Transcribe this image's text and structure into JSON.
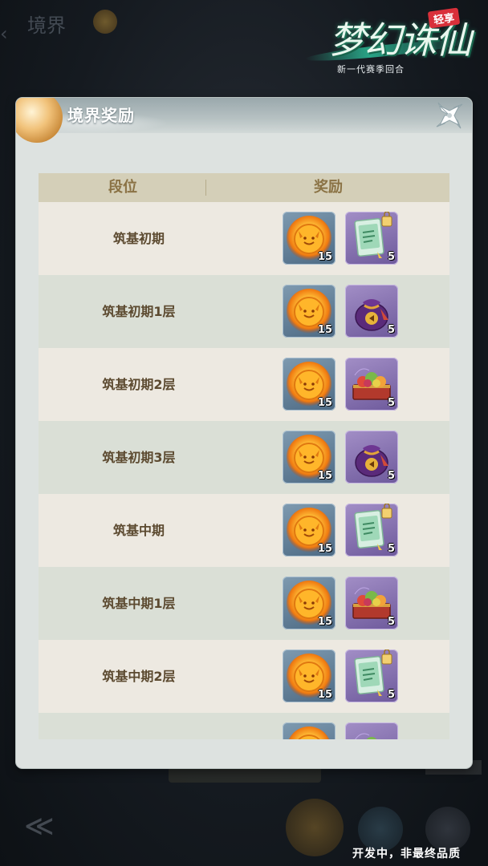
{
  "background": {
    "title": "境界",
    "logo": {
      "main": "梦幻诛仙",
      "tag": "轻享",
      "subtitle": "新一代赛季回合"
    },
    "footer_note": "开发中，非最终品质"
  },
  "dialog": {
    "title": "境界奖励",
    "columns": {
      "rank": "段位",
      "reward": "奖励"
    },
    "rows": [
      {
        "label": "筑基初期",
        "rewards": [
          {
            "icon": "fox-coin-icon",
            "qty": "15"
          },
          {
            "icon": "ticket-icon",
            "qty": "5"
          }
        ]
      },
      {
        "label": "筑基初期1层",
        "rewards": [
          {
            "icon": "fox-coin-icon",
            "qty": "15"
          },
          {
            "icon": "pouch-icon",
            "qty": "5"
          }
        ]
      },
      {
        "label": "筑基初期2层",
        "rewards": [
          {
            "icon": "fox-coin-icon",
            "qty": "15"
          },
          {
            "icon": "fruit-chest-icon",
            "qty": "5"
          }
        ]
      },
      {
        "label": "筑基初期3层",
        "rewards": [
          {
            "icon": "fox-coin-icon",
            "qty": "15"
          },
          {
            "icon": "pouch-icon",
            "qty": "5"
          }
        ]
      },
      {
        "label": "筑基中期",
        "rewards": [
          {
            "icon": "fox-coin-icon",
            "qty": "15"
          },
          {
            "icon": "ticket-icon",
            "qty": "5"
          }
        ]
      },
      {
        "label": "筑基中期1层",
        "rewards": [
          {
            "icon": "fox-coin-icon",
            "qty": "15"
          },
          {
            "icon": "fruit-chest-icon",
            "qty": "5"
          }
        ]
      },
      {
        "label": "筑基中期2层",
        "rewards": [
          {
            "icon": "fox-coin-icon",
            "qty": "15"
          },
          {
            "icon": "ticket-icon",
            "qty": "5"
          }
        ]
      },
      {
        "label": "",
        "rewards": [
          {
            "icon": "fox-coin-icon",
            "qty": ""
          },
          {
            "icon": "fruit-chest-icon",
            "qty": ""
          }
        ]
      }
    ]
  }
}
